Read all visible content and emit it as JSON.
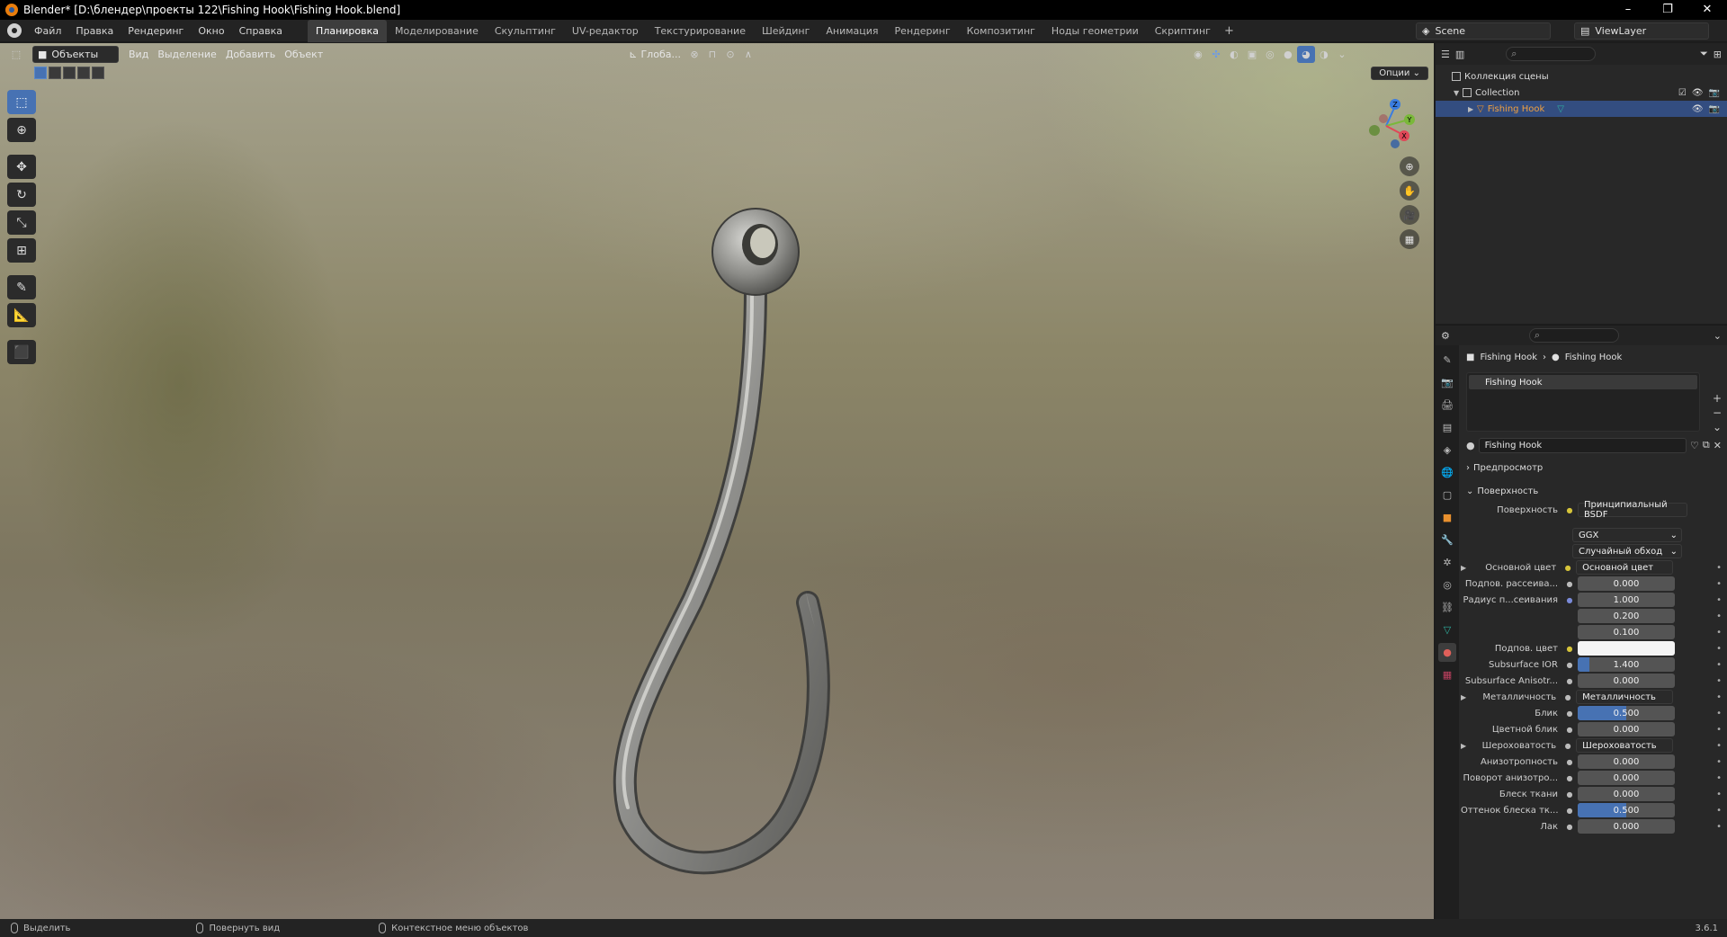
{
  "window": {
    "title": "Blender* [D:\\блендер\\проекты 122\\Fishing Hook\\Fishing Hook.blend]",
    "controls": [
      "–",
      "❐",
      "✕"
    ]
  },
  "menu": {
    "items": [
      "Файл",
      "Правка",
      "Рендеринг",
      "Окно",
      "Справка"
    ],
    "workspaces": [
      "Планировка",
      "Моделирование",
      "Скульптинг",
      "UV-редактор",
      "Текстурирование",
      "Шейдинг",
      "Анимация",
      "Рендеринг",
      "Композитинг",
      "Ноды геометрии",
      "Скриптинг"
    ],
    "active_workspace": "Планировка",
    "add_tab": "+",
    "scene": "Scene",
    "view_layer": "ViewLayer"
  },
  "viewport": {
    "mode": "Объекты",
    "menus": [
      "Вид",
      "Выделение",
      "Добавить",
      "Объект"
    ],
    "orientation": "Глоба...",
    "options": "Опции",
    "gizmo_axes": {
      "z": "Z",
      "y": "Y",
      "x": "X"
    },
    "object_color": "#8a8a88"
  },
  "outliner": {
    "scene_collection": "Коллекция сцены",
    "collection": "Collection",
    "object": "Fishing Hook"
  },
  "properties": {
    "breadcrumb": {
      "object": "Fishing Hook",
      "material": "Fishing Hook"
    },
    "slot": "Fishing Hook",
    "material_name": "Fishing Hook",
    "panels": {
      "preview": "Предпросмотр",
      "surface": "Поверхность"
    },
    "surface_label": "Поверхность",
    "surface_value": "Принципиальный BSDF",
    "distribution": "GGX",
    "subsurface_method": "Случайный обход",
    "rows": [
      {
        "label": "Основной цвет",
        "type": "link",
        "value": "Основной цвет",
        "expand": true,
        "dot": "y"
      },
      {
        "label": "Подпов. рассеива...",
        "type": "num",
        "value": "0.000",
        "dot": "n"
      },
      {
        "label": "Радиус п...сеивания",
        "type": "num",
        "value": "1.000",
        "dot": "p"
      },
      {
        "label": "",
        "type": "num",
        "value": "0.200",
        "dot": ""
      },
      {
        "label": "",
        "type": "num",
        "value": "0.100",
        "dot": ""
      },
      {
        "label": "Подпов. цвет",
        "type": "white",
        "value": "",
        "dot": "y"
      },
      {
        "label": "Subsurface IOR",
        "type": "num",
        "value": "1.400",
        "dot": "n",
        "fill": 0.12
      },
      {
        "label": "Subsurface Anisotr...",
        "type": "num",
        "value": "0.000",
        "dot": "n"
      },
      {
        "label": "Металличность",
        "type": "link",
        "value": "Металличность",
        "expand": true,
        "dot": "n"
      },
      {
        "label": "Блик",
        "type": "num",
        "value": "0.500",
        "dot": "n",
        "fill": 0.5
      },
      {
        "label": "Цветной блик",
        "type": "num",
        "value": "0.000",
        "dot": "n"
      },
      {
        "label": "Шероховатость",
        "type": "link",
        "value": "Шероховатость",
        "expand": true,
        "dot": "n"
      },
      {
        "label": "Анизотропность",
        "type": "num",
        "value": "0.000",
        "dot": "n"
      },
      {
        "label": "Поворот анизотро...",
        "type": "num",
        "value": "0.000",
        "dot": "n"
      },
      {
        "label": "Блеск ткани",
        "type": "num",
        "value": "0.000",
        "dot": "n"
      },
      {
        "label": "Оттенок блеска тк...",
        "type": "num",
        "value": "0.500",
        "dot": "n",
        "fill": 0.5
      },
      {
        "label": "Лак",
        "type": "num",
        "value": "0.000",
        "dot": "n"
      }
    ]
  },
  "status": {
    "select": "Выделить",
    "rotate": "Повернуть вид",
    "context": "Контекстное меню объектов",
    "version": "3.6.1"
  }
}
